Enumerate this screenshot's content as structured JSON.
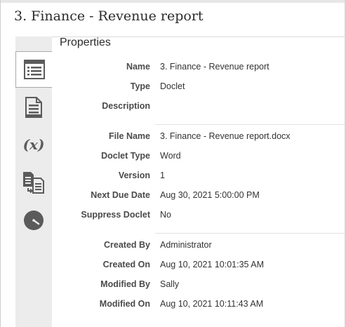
{
  "title": "3. Finance - Revenue report",
  "section_title": "Properties",
  "sidebar": {
    "tabs": [
      {
        "icon": "properties-list-icon",
        "active": true
      },
      {
        "icon": "document-icon",
        "active": false
      },
      {
        "icon": "variable-icon",
        "active": false
      },
      {
        "icon": "copy-documents-icon",
        "active": false
      },
      {
        "icon": "clock-icon",
        "active": false
      }
    ]
  },
  "properties": {
    "general": [
      {
        "label": "Name",
        "value": "3. Finance - Revenue report"
      },
      {
        "label": "Type",
        "value": "Doclet"
      },
      {
        "label": "Description",
        "value": ""
      }
    ],
    "file": [
      {
        "label": "File Name",
        "value": "3. Finance - Revenue report.docx"
      },
      {
        "label": "Doclet Type",
        "value": "Word"
      },
      {
        "label": "Version",
        "value": "1"
      },
      {
        "label": "Next Due Date",
        "value": "Aug 30, 2021 5:00:00 PM"
      },
      {
        "label": "Suppress Doclet",
        "value": "No"
      }
    ],
    "audit": [
      {
        "label": "Created By",
        "value": "Administrator"
      },
      {
        "label": "Created On",
        "value": "Aug 10, 2021 10:01:35 AM"
      },
      {
        "label": "Modified By",
        "value": "Sally"
      },
      {
        "label": "Modified On",
        "value": "Aug 10, 2021 10:11:43 AM"
      }
    ]
  },
  "colors": {
    "icon": "#5b5b5b",
    "rail_background": "#ececec"
  }
}
